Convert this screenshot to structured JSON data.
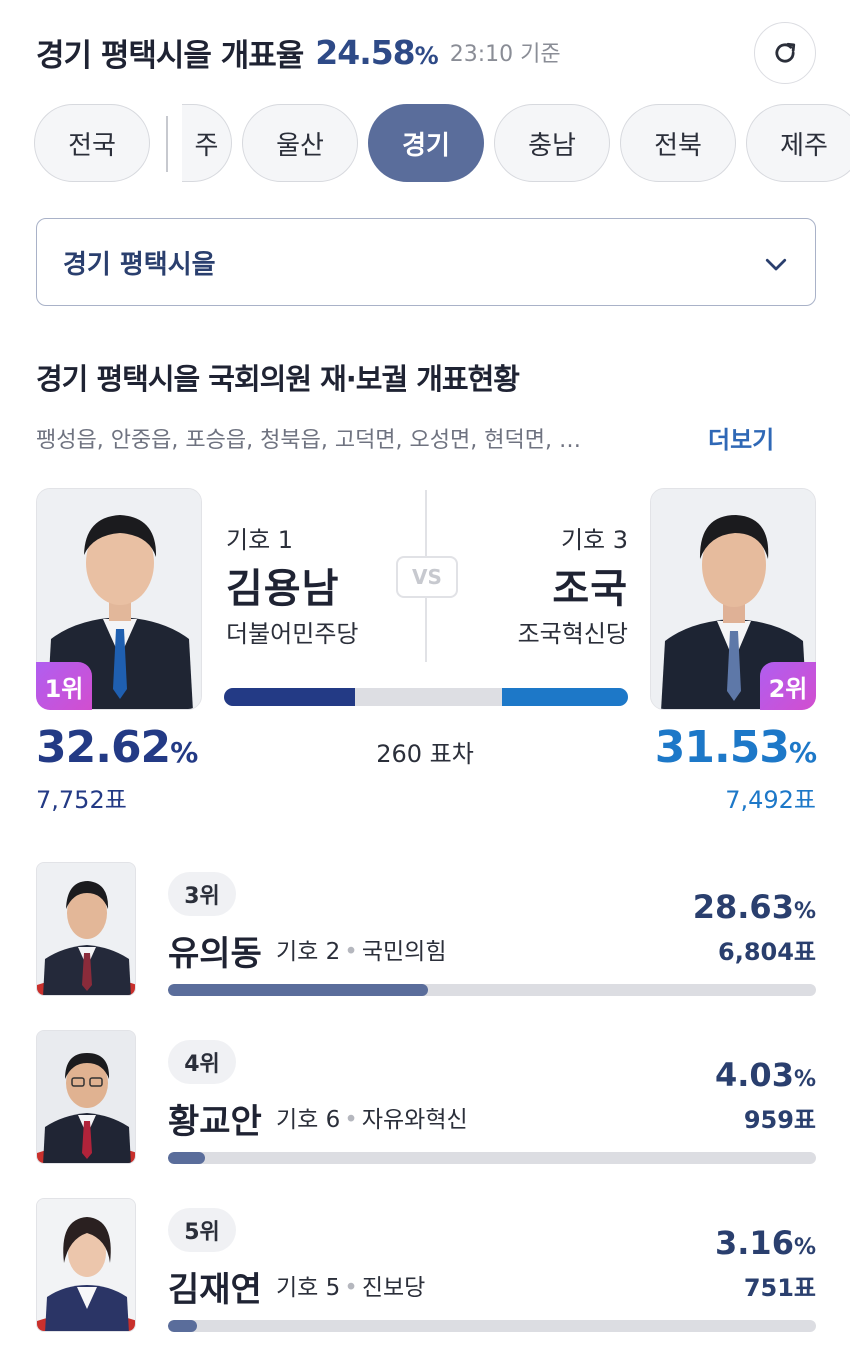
{
  "header": {
    "title": "경기 평택시을 개표율",
    "count_rate": "24.58",
    "pct_sign": "%",
    "time": "23:10 기준",
    "refresh_icon": "refresh-icon"
  },
  "tabs": [
    "전국",
    "주",
    "울산",
    "경기",
    "충남",
    "전북",
    "제주"
  ],
  "active_tab": "경기",
  "dropdown": {
    "label": "경기 평택시을",
    "icon": "chevron-down-icon"
  },
  "section": {
    "title": "경기 평택시을 국회의원 재·보궐 개표현황",
    "areas": "팽성읍, 안중읍, 포승읍, 청북읍, 고덕면, 오성면, 현덕면,  …",
    "more": "더보기"
  },
  "matchup": {
    "vs": "VS",
    "gap": "260 표차",
    "left": {
      "rank": "1위",
      "number": "기호 1",
      "name": "김용남",
      "party": "더불어민주당",
      "pct": "32.62",
      "pct_sign": "%",
      "votes": "7,752표",
      "share": 32.62,
      "color": "#233a85"
    },
    "right": {
      "rank": "2위",
      "number": "기호 3",
      "name": "조국",
      "party": "조국혁신당",
      "pct": "31.53",
      "pct_sign": "%",
      "votes": "7,492표",
      "share": 31.53,
      "color": "#1d78c8"
    }
  },
  "others": [
    {
      "rank": "3위",
      "name": "유의동",
      "number": "기호 2",
      "party": "국민의힘",
      "pct": "28.63",
      "pct_sign": "%",
      "votes": "6,804표",
      "share": 28.63
    },
    {
      "rank": "4위",
      "name": "황교안",
      "number": "기호 6",
      "party": "자유와혁신",
      "pct": "4.03",
      "pct_sign": "%",
      "votes": "959표",
      "share": 4.03
    },
    {
      "rank": "5위",
      "name": "김재연",
      "number": "기호 5",
      "party": "진보당",
      "pct": "3.16",
      "pct_sign": "%",
      "votes": "751표",
      "share": 3.16
    }
  ],
  "colors": {
    "accent": "#5a6d9b",
    "navy": "#2a3f6e",
    "badge": "#c456e0"
  }
}
